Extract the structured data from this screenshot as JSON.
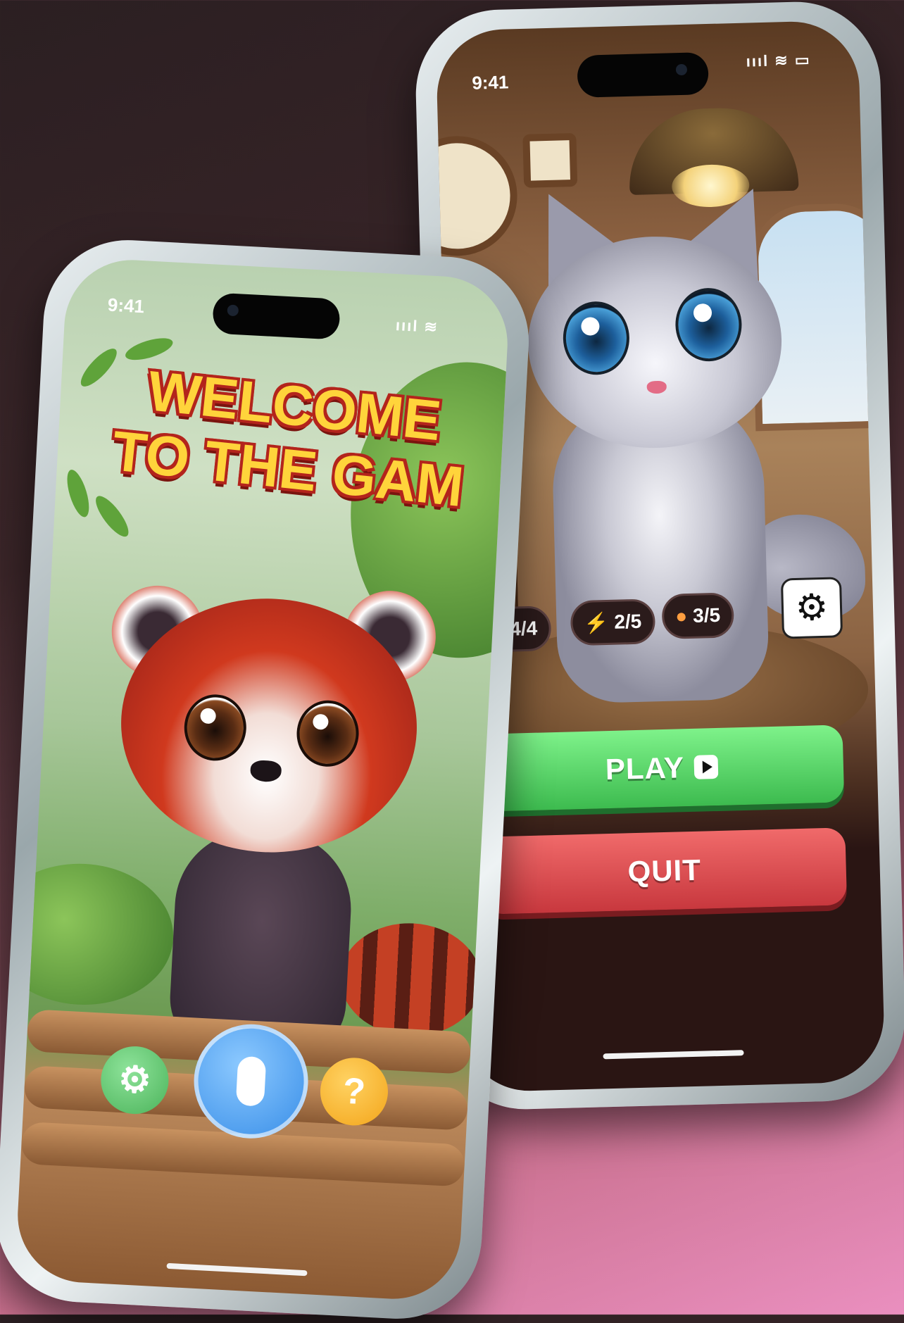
{
  "kitten_screen": {
    "status_time": "9:41",
    "status_icons": "ıııl ≋ ▭",
    "stats": [
      {
        "icon": "heart-icon",
        "glyph": "♥",
        "color": "#e53935",
        "value": "4/4"
      },
      {
        "icon": "lightning-icon",
        "glyph": "⚡",
        "color": "#ffc107",
        "value": "2/5"
      },
      {
        "icon": "paw-icon",
        "glyph": "🐾",
        "color": "#ff9e40",
        "value": "3/5"
      }
    ],
    "settings_glyph": "⚙",
    "play_label": "PLAY",
    "quit_label": "QUIT"
  },
  "panda_screen": {
    "status_time": "9:41",
    "status_icons": "ıııl ≋",
    "welcome_line1": "WELCOME",
    "welcome_line2": "TO THE GAM",
    "settings_glyph": "⚙",
    "help_glyph": "?"
  },
  "colors": {
    "play_green": "#4cd964",
    "quit_red": "#e04848",
    "mic_blue": "#3a8fe8",
    "settings_green": "#5cc46b",
    "help_orange": "#f3a51a",
    "welcome_yellow": "#ffd43b",
    "welcome_outline": "#b3241c"
  }
}
